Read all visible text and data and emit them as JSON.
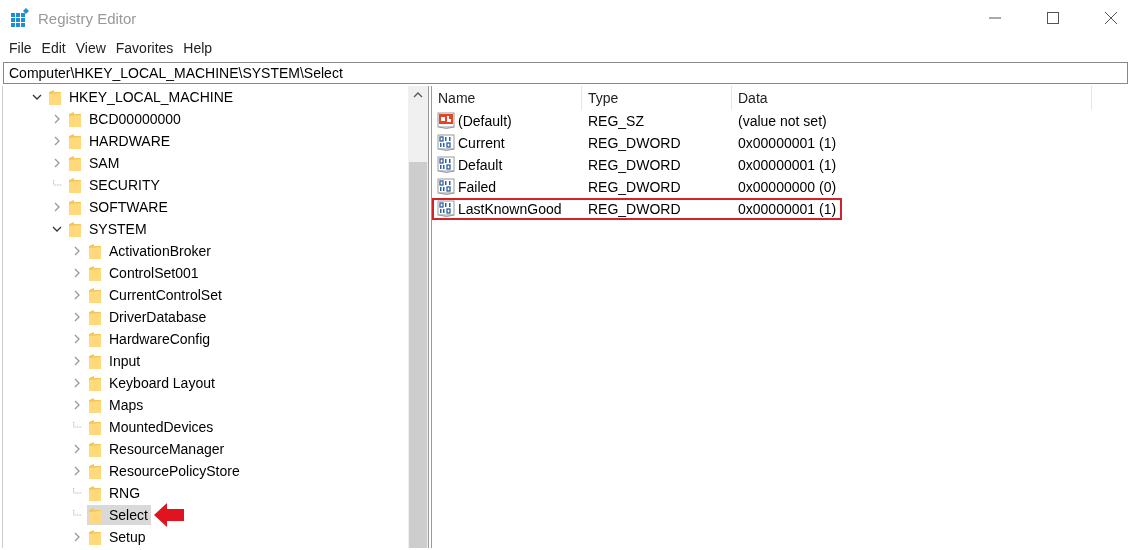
{
  "window": {
    "title": "Registry Editor"
  },
  "menu": [
    "File",
    "Edit",
    "View",
    "Favorites",
    "Help"
  ],
  "address": "Computer\\HKEY_LOCAL_MACHINE\\SYSTEM\\Select",
  "tree": [
    {
      "label": "HKEY_LOCAL_MACHINE",
      "expandable": true,
      "expanded": true,
      "selected": false,
      "annotated": false,
      "children": [
        {
          "label": "BCD00000000",
          "expandable": true,
          "expanded": false,
          "selected": false,
          "annotated": false
        },
        {
          "label": "HARDWARE",
          "expandable": true,
          "expanded": false,
          "selected": false,
          "annotated": false
        },
        {
          "label": "SAM",
          "expandable": true,
          "expanded": false,
          "selected": false,
          "annotated": false
        },
        {
          "label": "SECURITY",
          "expandable": false,
          "expanded": false,
          "selected": false,
          "annotated": false
        },
        {
          "label": "SOFTWARE",
          "expandable": true,
          "expanded": false,
          "selected": false,
          "annotated": false
        },
        {
          "label": "SYSTEM",
          "expandable": true,
          "expanded": true,
          "selected": false,
          "annotated": false,
          "children": [
            {
              "label": "ActivationBroker",
              "expandable": true,
              "expanded": false,
              "selected": false,
              "annotated": false
            },
            {
              "label": "ControlSet001",
              "expandable": true,
              "expanded": false,
              "selected": false,
              "annotated": false
            },
            {
              "label": "CurrentControlSet",
              "expandable": true,
              "expanded": false,
              "selected": false,
              "annotated": false
            },
            {
              "label": "DriverDatabase",
              "expandable": true,
              "expanded": false,
              "selected": false,
              "annotated": false
            },
            {
              "label": "HardwareConfig",
              "expandable": true,
              "expanded": false,
              "selected": false,
              "annotated": false
            },
            {
              "label": "Input",
              "expandable": true,
              "expanded": false,
              "selected": false,
              "annotated": false
            },
            {
              "label": "Keyboard Layout",
              "expandable": true,
              "expanded": false,
              "selected": false,
              "annotated": false
            },
            {
              "label": "Maps",
              "expandable": true,
              "expanded": false,
              "selected": false,
              "annotated": false
            },
            {
              "label": "MountedDevices",
              "expandable": false,
              "expanded": false,
              "selected": false,
              "annotated": false
            },
            {
              "label": "ResourceManager",
              "expandable": true,
              "expanded": false,
              "selected": false,
              "annotated": false
            },
            {
              "label": "ResourcePolicyStore",
              "expandable": true,
              "expanded": false,
              "selected": false,
              "annotated": false
            },
            {
              "label": "RNG",
              "expandable": false,
              "expanded": false,
              "selected": false,
              "annotated": false
            },
            {
              "label": "Select",
              "expandable": false,
              "expanded": false,
              "selected": true,
              "annotated": true
            },
            {
              "label": "Setup",
              "expandable": true,
              "expanded": false,
              "selected": false,
              "annotated": false
            }
          ]
        }
      ]
    }
  ],
  "table": {
    "columns": [
      "Name",
      "Type",
      "Data"
    ],
    "rows": [
      {
        "kind": "string",
        "name": "(Default)",
        "type": "REG_SZ",
        "data": "(value not set)",
        "highlighted": false
      },
      {
        "kind": "dword",
        "name": "Current",
        "type": "REG_DWORD",
        "data": "0x00000001 (1)",
        "highlighted": false
      },
      {
        "kind": "dword",
        "name": "Default",
        "type": "REG_DWORD",
        "data": "0x00000001 (1)",
        "highlighted": false
      },
      {
        "kind": "dword",
        "name": "Failed",
        "type": "REG_DWORD",
        "data": "0x00000000 (0)",
        "highlighted": false
      },
      {
        "kind": "dword",
        "name": "LastKnownGood",
        "type": "REG_DWORD",
        "data": "0x00000001 (1)",
        "highlighted": true
      }
    ]
  }
}
